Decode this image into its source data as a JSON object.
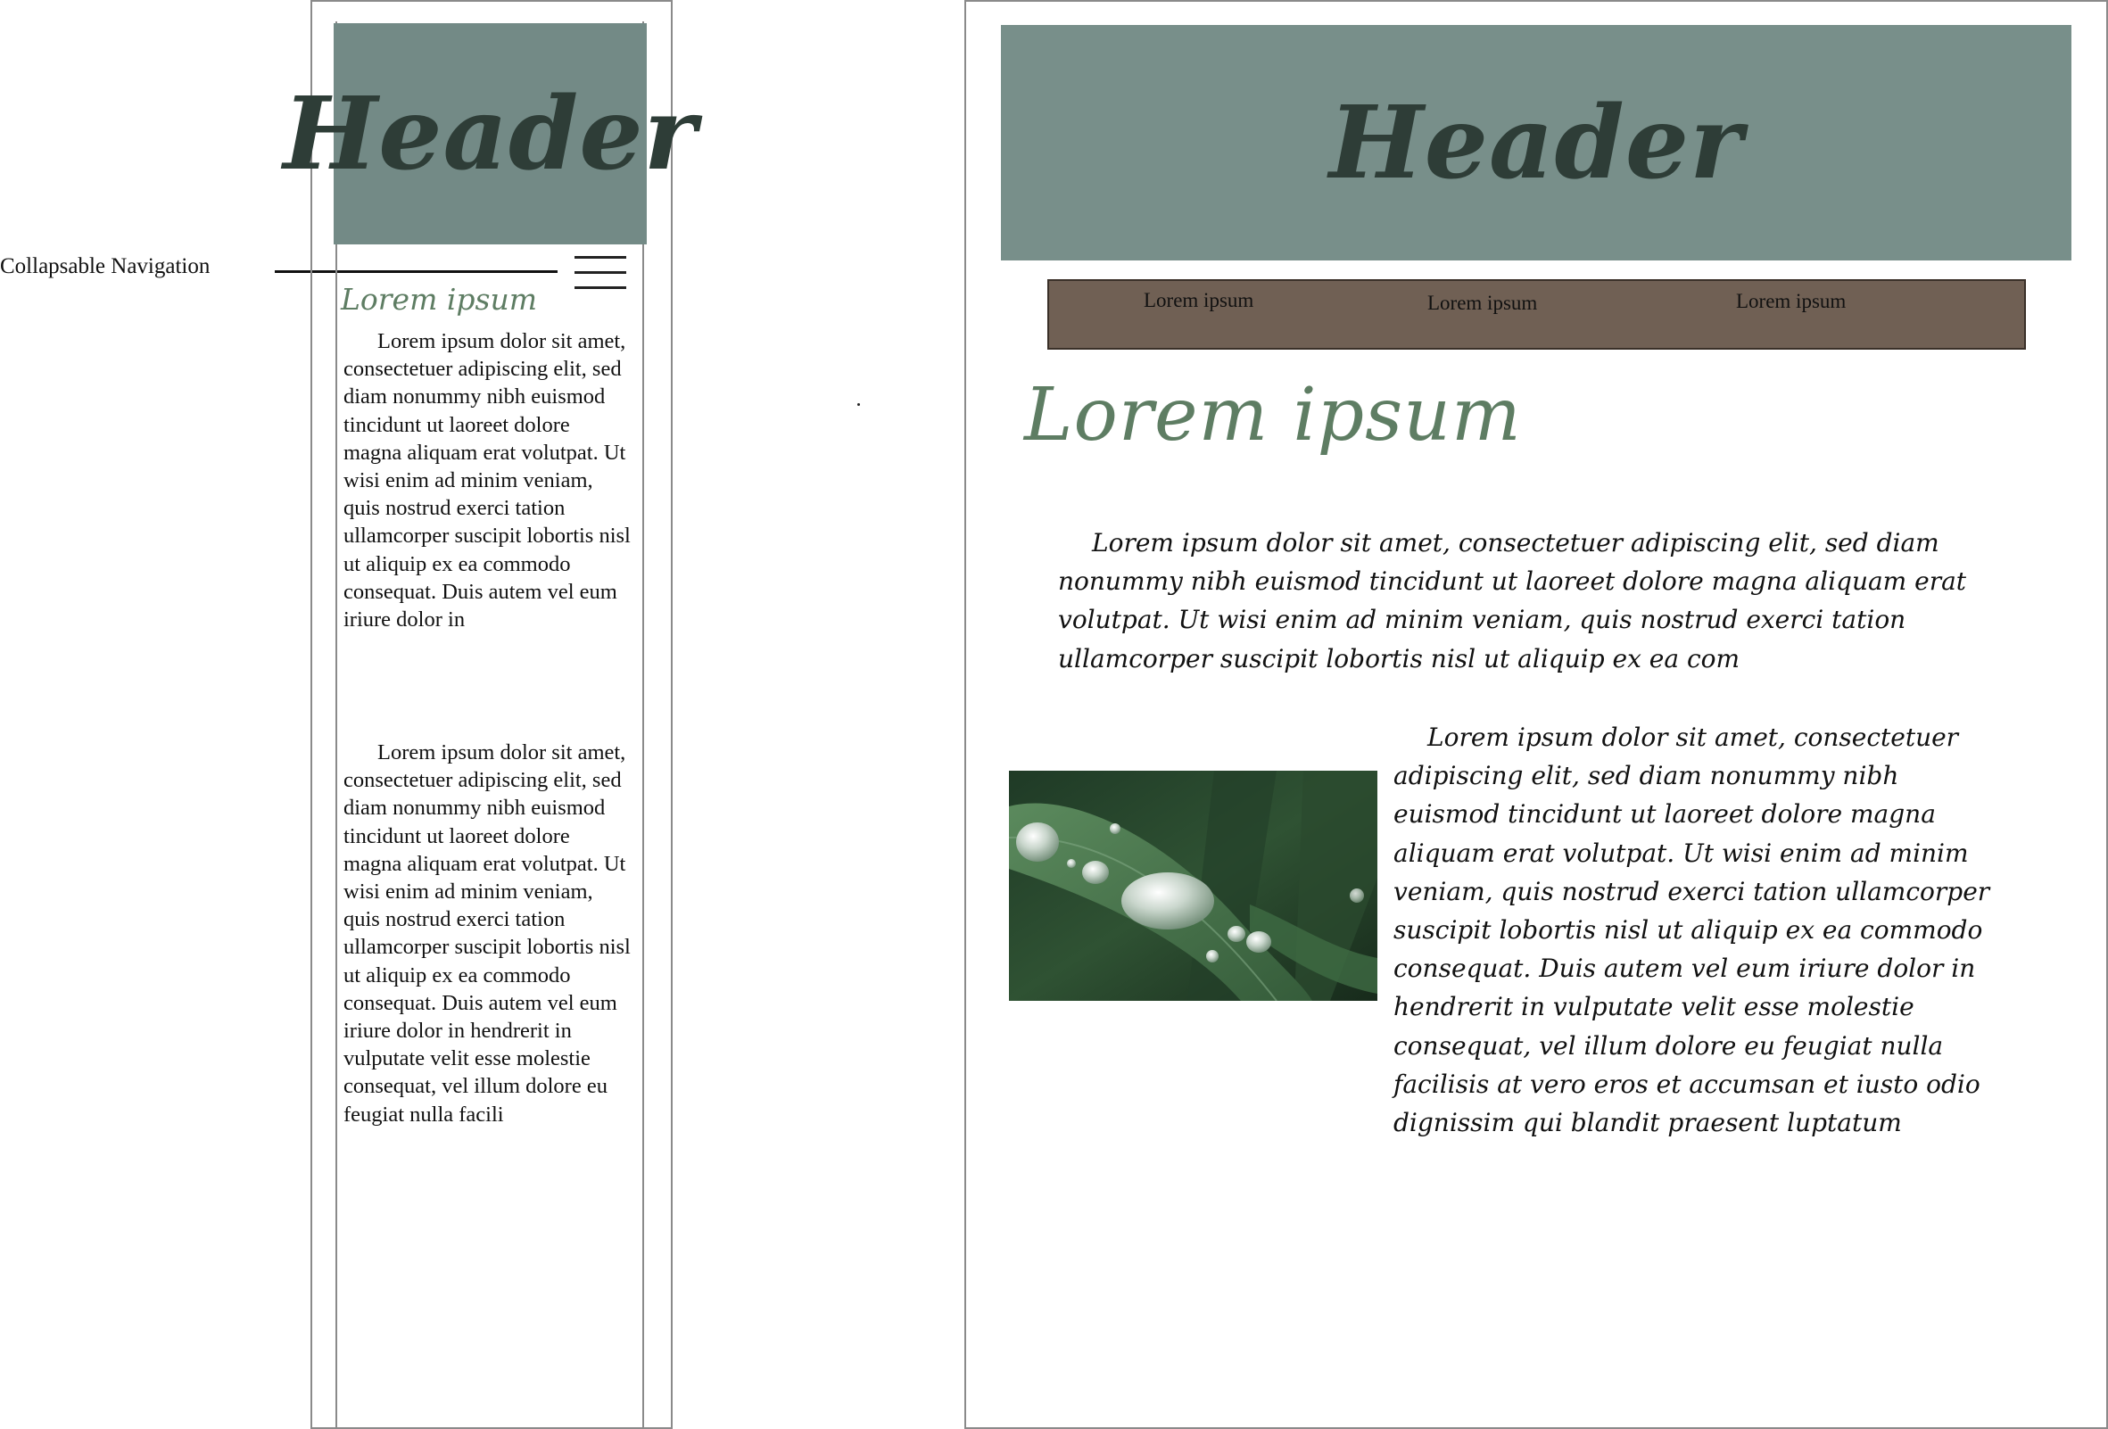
{
  "annotation": {
    "label": "Collapsable Navigation"
  },
  "mobile": {
    "header": "Header",
    "menu_icon": "hamburger-menu-icon",
    "title": "Lorem ipsum",
    "paragraphs": [
      "Lorem ipsum dolor sit amet, consectetuer adipiscing elit, sed diam nonummy nibh euismod tincidunt ut laoreet dolore magna aliquam erat volutpat. Ut wisi enim ad minim veniam, quis nostrud exerci tation ullamcorper suscipit lobortis nisl ut aliquip ex ea commodo consequat. Duis autem vel eum iriure dolor in",
      "Lorem ipsum dolor sit amet, consectetuer adipiscing elit, sed diam nonummy nibh euismod tincidunt ut laoreet dolore magna aliquam erat volutpat. Ut wisi enim ad minim veniam, quis nostrud exerci tation ullamcorper suscipit lobortis nisl ut aliquip ex ea commodo consequat. Duis autem vel eum iriure dolor in hendrerit in vulputate velit esse molestie consequat, vel illum dolore eu feugiat nulla facili"
    ]
  },
  "desktop": {
    "header": "Header",
    "nav": [
      "Lorem ipsum",
      "Lorem ipsum",
      "Lorem ipsum"
    ],
    "title": "Lorem ipsum",
    "paragraphs": [
      "Lorem ipsum dolor sit amet, consectetuer adipiscing elit, sed diam nonummy nibh euismod tincidunt ut laoreet dolore magna aliquam erat volutpat. Ut wisi enim ad minim veniam, quis nostrud exerci tation ullamcorper suscipit lobortis nisl ut aliquip ex ea com",
      "Lorem ipsum dolor sit amet, consectetuer adipiscing elit, sed diam nonummy nibh euismod tincidunt ut laoreet dolore magna aliquam erat volutpat. Ut wisi enim ad minim veniam, quis nostrud exerci tation ullamcorper suscipit lobortis nisl ut aliquip ex ea commodo consequat. Duis autem vel eum iriure dolor in hendrerit in vulputate velit esse molestie consequat, vel illum dolore eu feugiat nulla facilisis at vero eros et accumsan et iusto odio dignissim qui blandit praesent luptatum"
    ],
    "image_icon": "leaf-water-droplets-photo"
  },
  "colors": {
    "header_bg_mobile": "#738a86",
    "header_bg_desktop": "#788f8a",
    "header_text": "#2e3d37",
    "nav_bg": "#706054",
    "title_green": "#5e7d63"
  }
}
